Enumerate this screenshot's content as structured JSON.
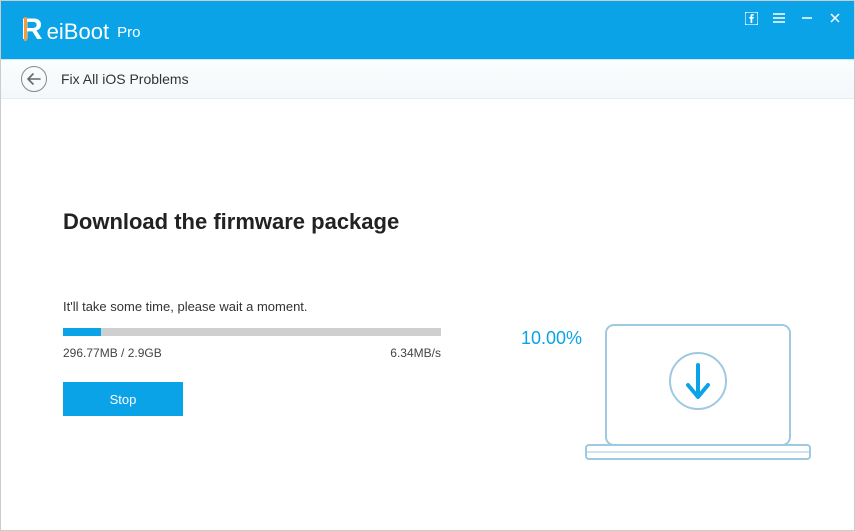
{
  "brand": {
    "main": "eiBoot",
    "suffix": "Pro"
  },
  "subheader": {
    "title": "Fix All iOS Problems"
  },
  "content": {
    "heading": "Download the firmware package",
    "subtext": "It'll take some time, please wait a moment.",
    "downloaded": "296.77MB / 2.9GB",
    "speed": "6.34MB/s",
    "percent_label": "10.00%",
    "percent_value": 10,
    "stop_label": "Stop"
  },
  "colors": {
    "accent": "#0ba3e8"
  }
}
